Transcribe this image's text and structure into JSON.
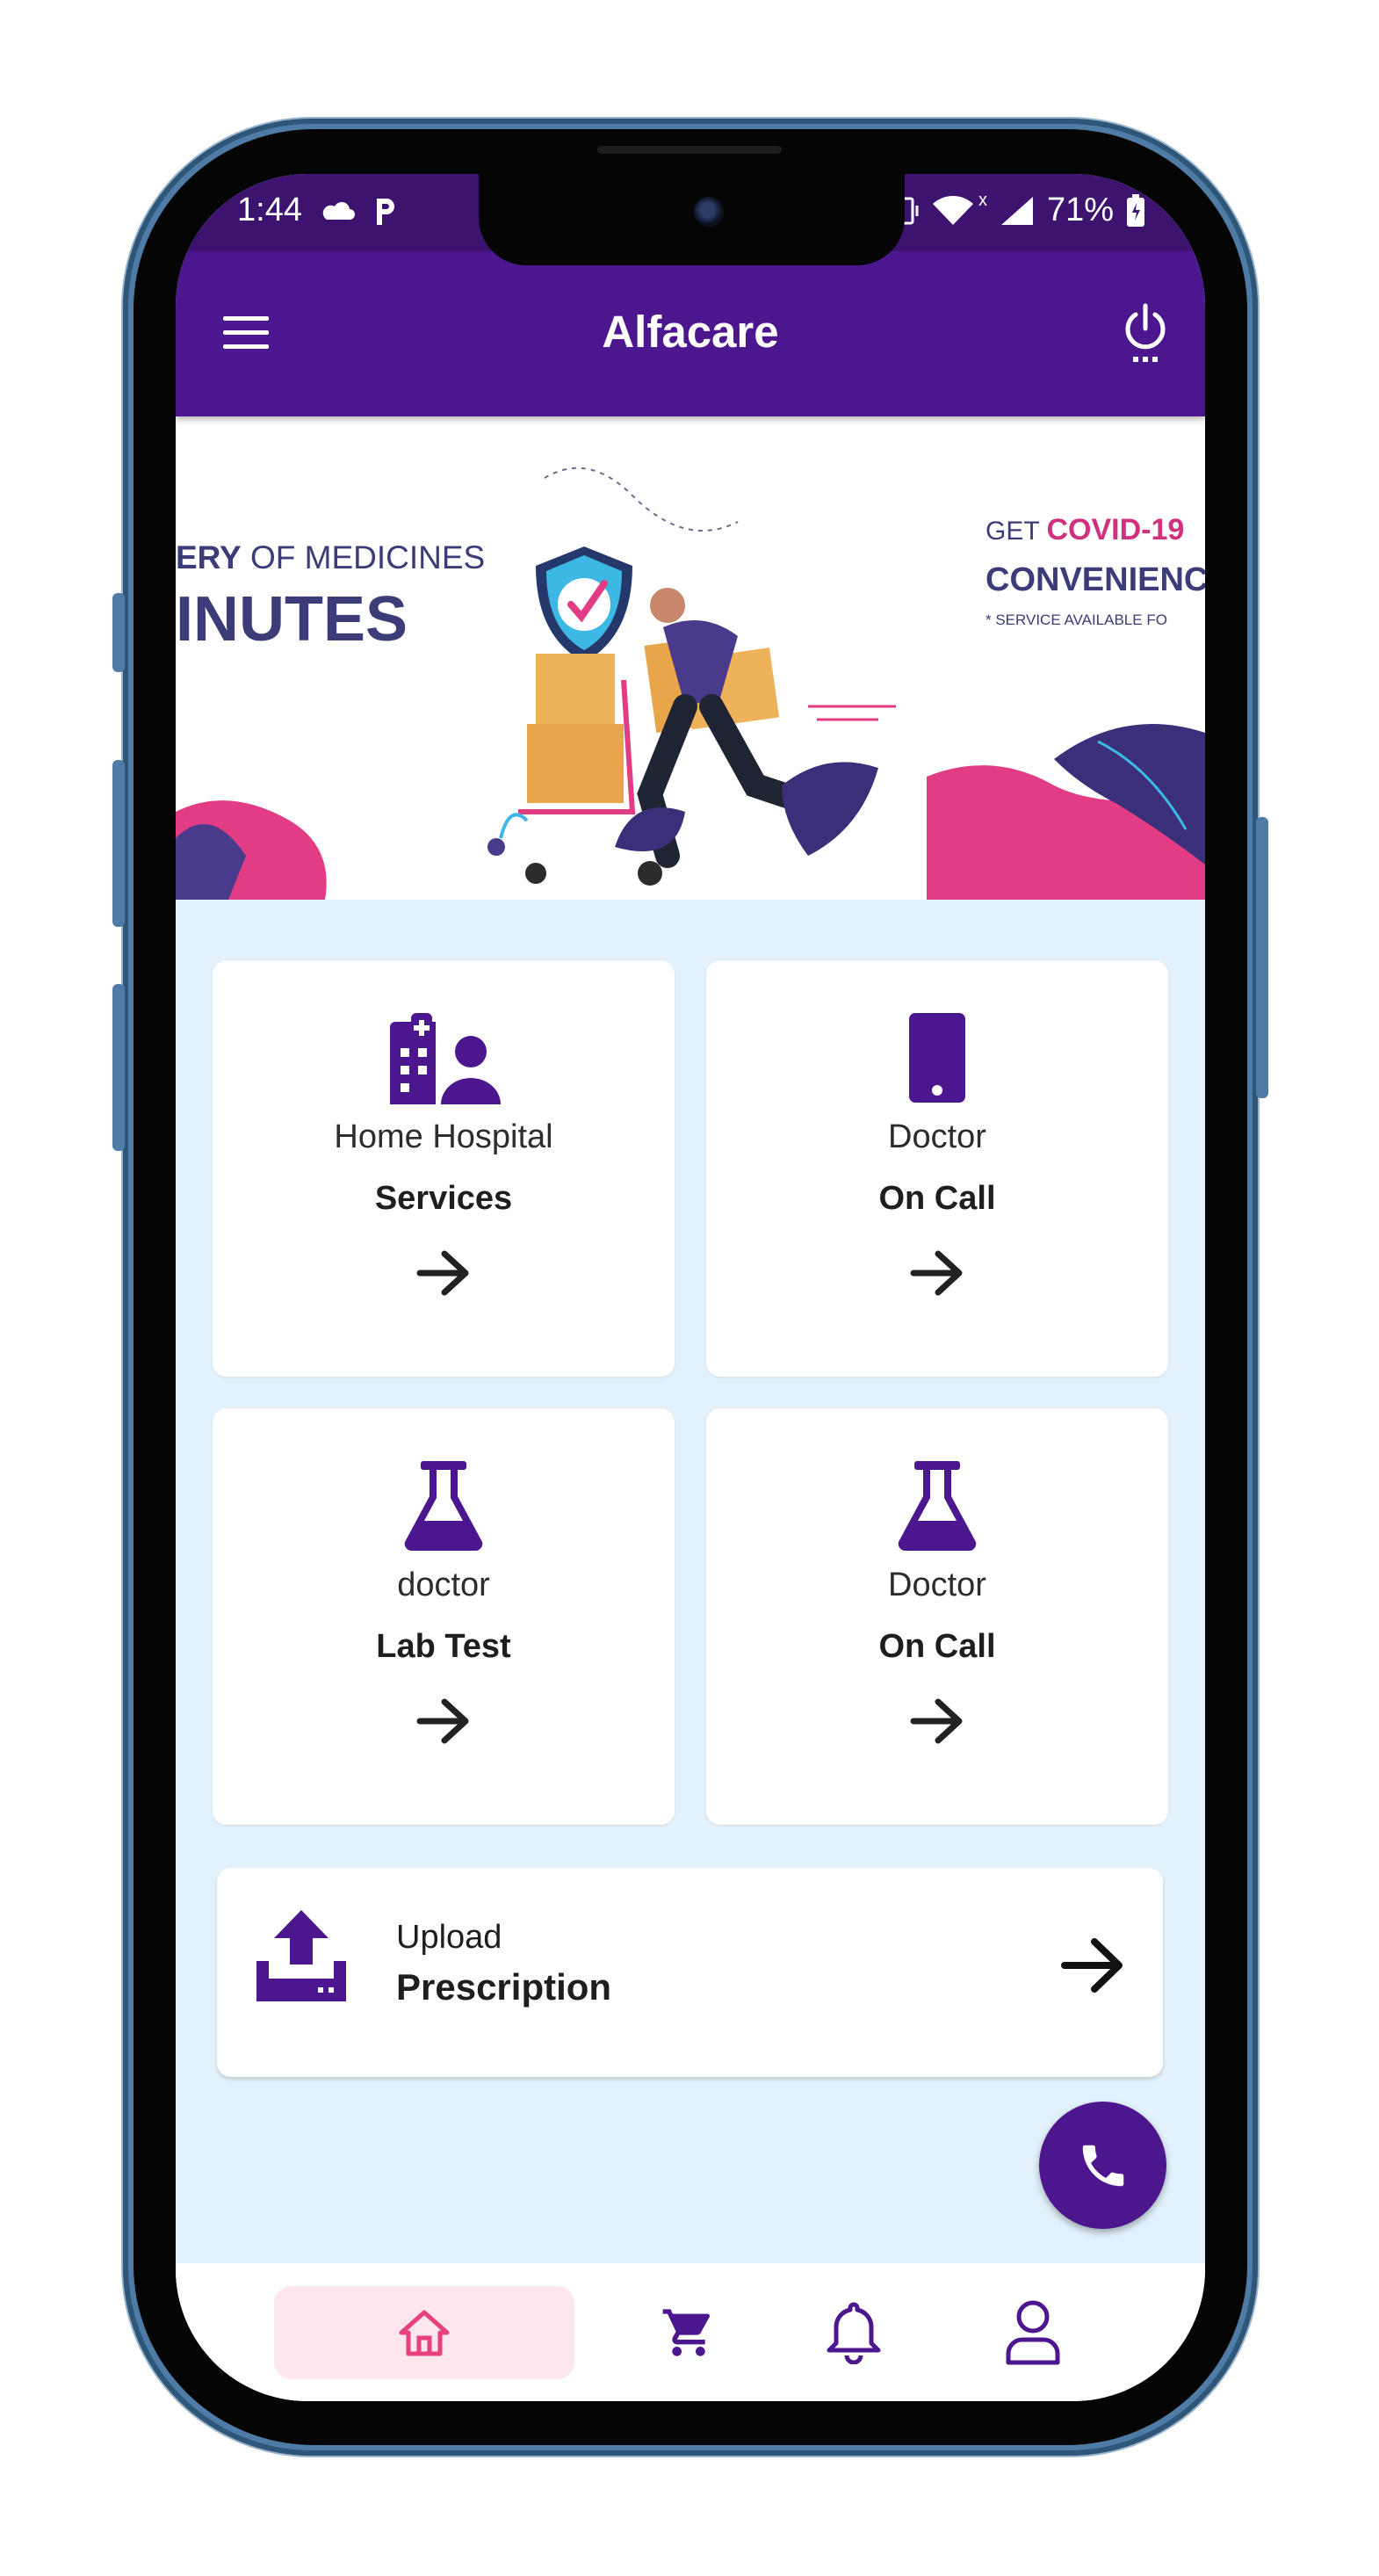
{
  "status_bar": {
    "time": "1:44",
    "battery": "71%",
    "network_badge": "x"
  },
  "app_bar": {
    "title": "Alfacare"
  },
  "banner": {
    "left_line1_bold": "ERY",
    "left_line1_rest": " OF MEDICINES",
    "left_line2": "INUTES",
    "right_line1_prefix": "GET ",
    "right_line1_highlight": "COVID-19",
    "right_line2": "CONVENIENC",
    "right_line3": "* SERVICE AVAILABLE FO"
  },
  "cards": [
    {
      "line1": "Home Hospital",
      "line2": "Services",
      "icon": "hospital-user-icon"
    },
    {
      "line1": "Doctor",
      "line2": "On Call",
      "icon": "smartphone-icon"
    },
    {
      "line1": "doctor",
      "line2": "Lab Test",
      "icon": "flask-icon"
    },
    {
      "line1": "Doctor",
      "line2": "On Call",
      "icon": "flask-icon"
    }
  ],
  "upload": {
    "line1": "Upload",
    "line2": "Prescription",
    "icon": "upload-tray-icon"
  },
  "fab": {
    "icon": "phone-icon"
  },
  "bottom_nav": [
    {
      "icon": "home-icon",
      "active": true
    },
    {
      "icon": "cart-icon",
      "active": false
    },
    {
      "icon": "bell-icon",
      "active": false
    },
    {
      "icon": "profile-icon",
      "active": false
    }
  ],
  "colors": {
    "primary": "#4c178e",
    "status_bar": "#3d1370",
    "background": "#e2f1fb",
    "accent_pink": "#e7407f",
    "nav_active_bg": "#fde6ee",
    "text_dark": "#1e1e1e"
  }
}
